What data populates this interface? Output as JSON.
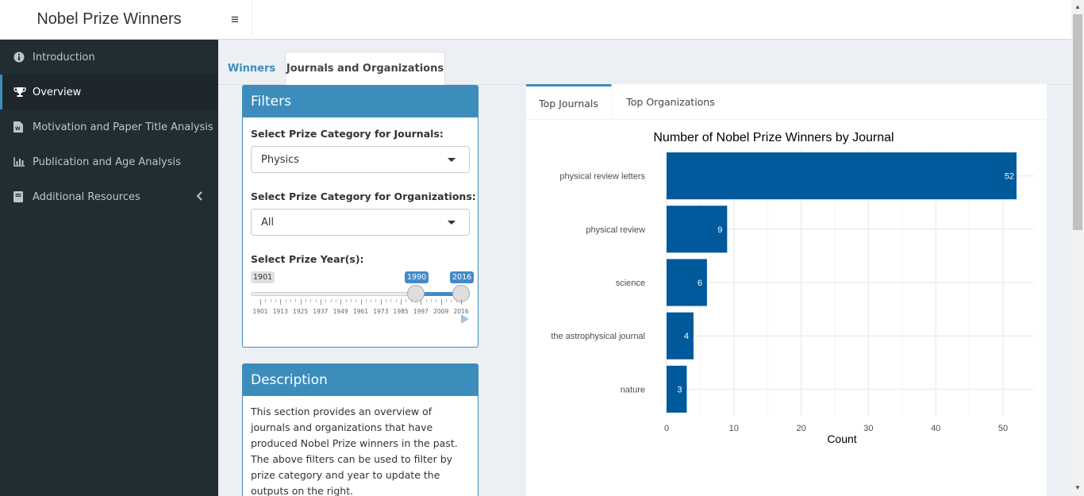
{
  "header": {
    "app_title": "Nobel Prize Winners",
    "toggle_icon": "hamburger-icon"
  },
  "sidebar": {
    "items": [
      {
        "label": "Introduction",
        "icon": "info-circle-icon"
      },
      {
        "label": "Overview",
        "icon": "trophy-icon"
      },
      {
        "label": "Motivation and Paper Title Analysis",
        "icon": "word-file-icon"
      },
      {
        "label": "Publication and Age Analysis",
        "icon": "bar-chart-icon"
      },
      {
        "label": "Additional Resources",
        "icon": "book-icon"
      }
    ]
  },
  "tabs": {
    "winners": "Winners",
    "journals_orgs": "Journals and Organizations"
  },
  "filters": {
    "title": "Filters",
    "journal_label": "Select Prize Category for Journals:",
    "journal_value": "Physics",
    "org_label": "Select Prize Category for Organizations:",
    "org_value": "All",
    "year_label": "Select Prize Year(s):",
    "year_min": "1901",
    "year_from": "1990",
    "year_to": "2016",
    "ticks": [
      "1901",
      "1913",
      "1925",
      "1937",
      "1949",
      "1961",
      "1973",
      "1985",
      "1997",
      "2009",
      "2016"
    ]
  },
  "description": {
    "title": "Description",
    "text": "This section provides an overview of journals and organizations that have produced Nobel Prize winners in the past. The above filters can be used to filter by prize category and year to update the outputs on the right."
  },
  "inner_tabs": {
    "journals": "Top Journals",
    "orgs": "Top Organizations"
  },
  "chart_data": {
    "type": "bar",
    "orientation": "horizontal",
    "title": "Number of Nobel Prize Winners by Journal",
    "xlabel": "Count",
    "ylabel": "",
    "categories": [
      "physical review letters",
      "physical review",
      "science",
      "the astrophysical journal",
      "nature"
    ],
    "values": [
      52,
      9,
      6,
      4,
      3
    ],
    "xlim": [
      0,
      54.6
    ],
    "xticks": [
      0,
      10,
      20,
      30,
      40,
      50
    ],
    "bar_color": "#00599a",
    "grid": true
  }
}
